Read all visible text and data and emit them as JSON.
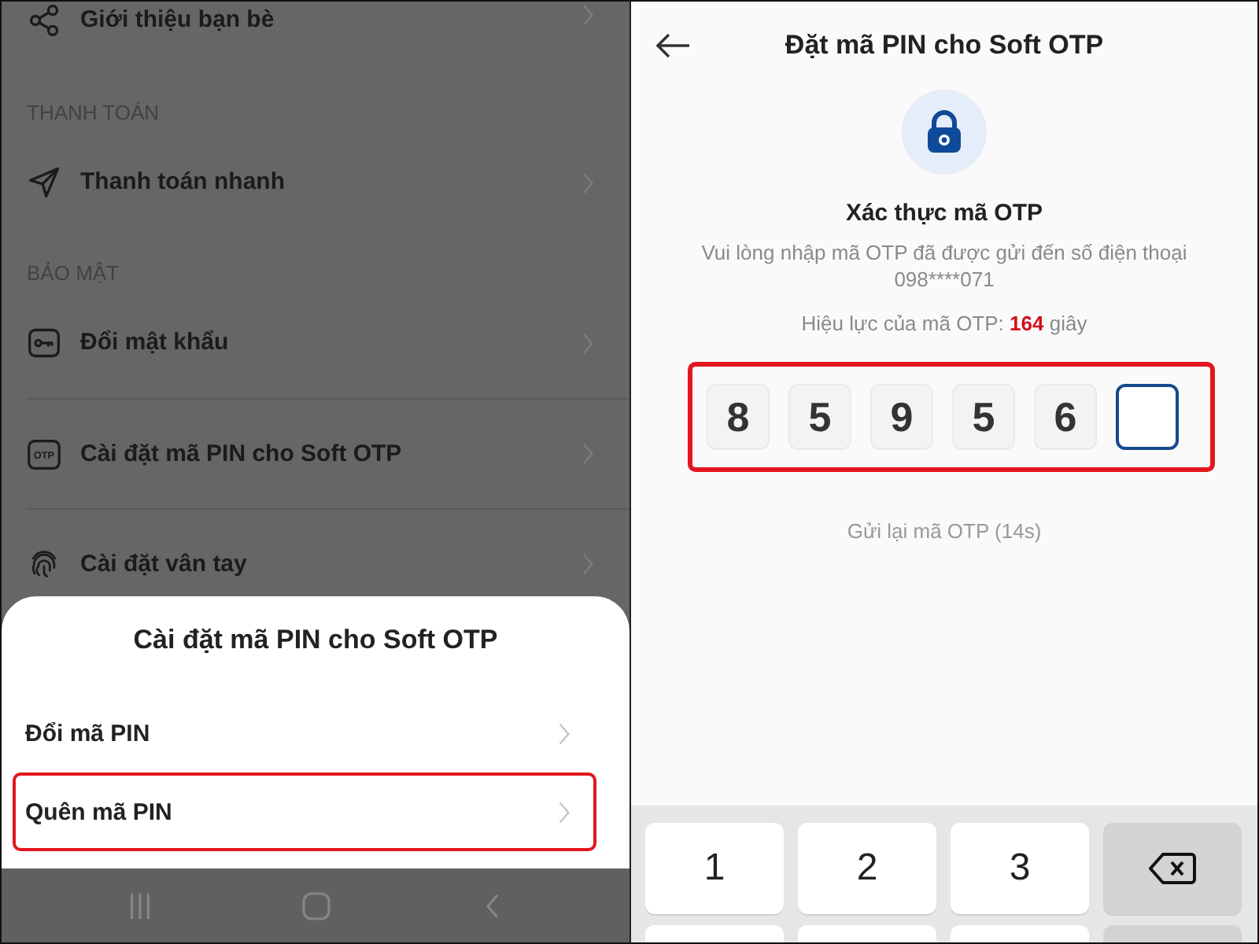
{
  "settings_screen": {
    "dimmed": true,
    "sections": [
      {
        "items": [
          {
            "label": "Giới thiệu bạn bè"
          }
        ]
      },
      {
        "header": "THANH TOÁN",
        "items": [
          {
            "label": "Thanh toán nhanh"
          }
        ]
      },
      {
        "header": "BẢO MẬT",
        "items": [
          {
            "label": "Đổi mật khẩu"
          },
          {
            "label": "Cài đặt mã PIN cho Soft OTP",
            "icon_text": "OTP"
          },
          {
            "label": "Cài đặt vân tay"
          }
        ]
      }
    ]
  },
  "bottom_sheet": {
    "title": "Cài đặt mã PIN cho Soft OTP",
    "options": [
      {
        "label": "Đổi mã PIN",
        "highlighted": false
      },
      {
        "label": "Quên mã PIN",
        "highlighted": true
      }
    ]
  },
  "otp_screen": {
    "title": "Đặt mã PIN cho Soft OTP",
    "heading": "Xác thực mã OTP",
    "message": "Vui lòng nhập mã OTP đã được gửi đến số điện thoại 098****071",
    "validity": "Hiệu lực của mã OTP: **164** giây",
    "otp": {
      "highlighted": true,
      "digits": [
        {
          "value": "8",
          "focused": false
        },
        {
          "value": "5",
          "focused": false
        },
        {
          "value": "9",
          "focused": false
        },
        {
          "value": "5",
          "focused": false
        },
        {
          "value": "6",
          "focused": false
        },
        {
          "focused": true
        }
      ]
    },
    "resend": "Gửi lại mã OTP (14s)",
    "keypad": {
      "rows": [
        [
          {
            "kind": "digit",
            "label": "1"
          },
          {
            "kind": "digit",
            "label": "2"
          },
          {
            "kind": "digit",
            "label": "3"
          },
          {
            "kind": "backspace"
          }
        ],
        [
          {
            "kind": "digit"
          },
          {
            "kind": "digit"
          },
          {
            "kind": "digit"
          },
          {
            "kind": "action"
          }
        ]
      ]
    }
  }
}
